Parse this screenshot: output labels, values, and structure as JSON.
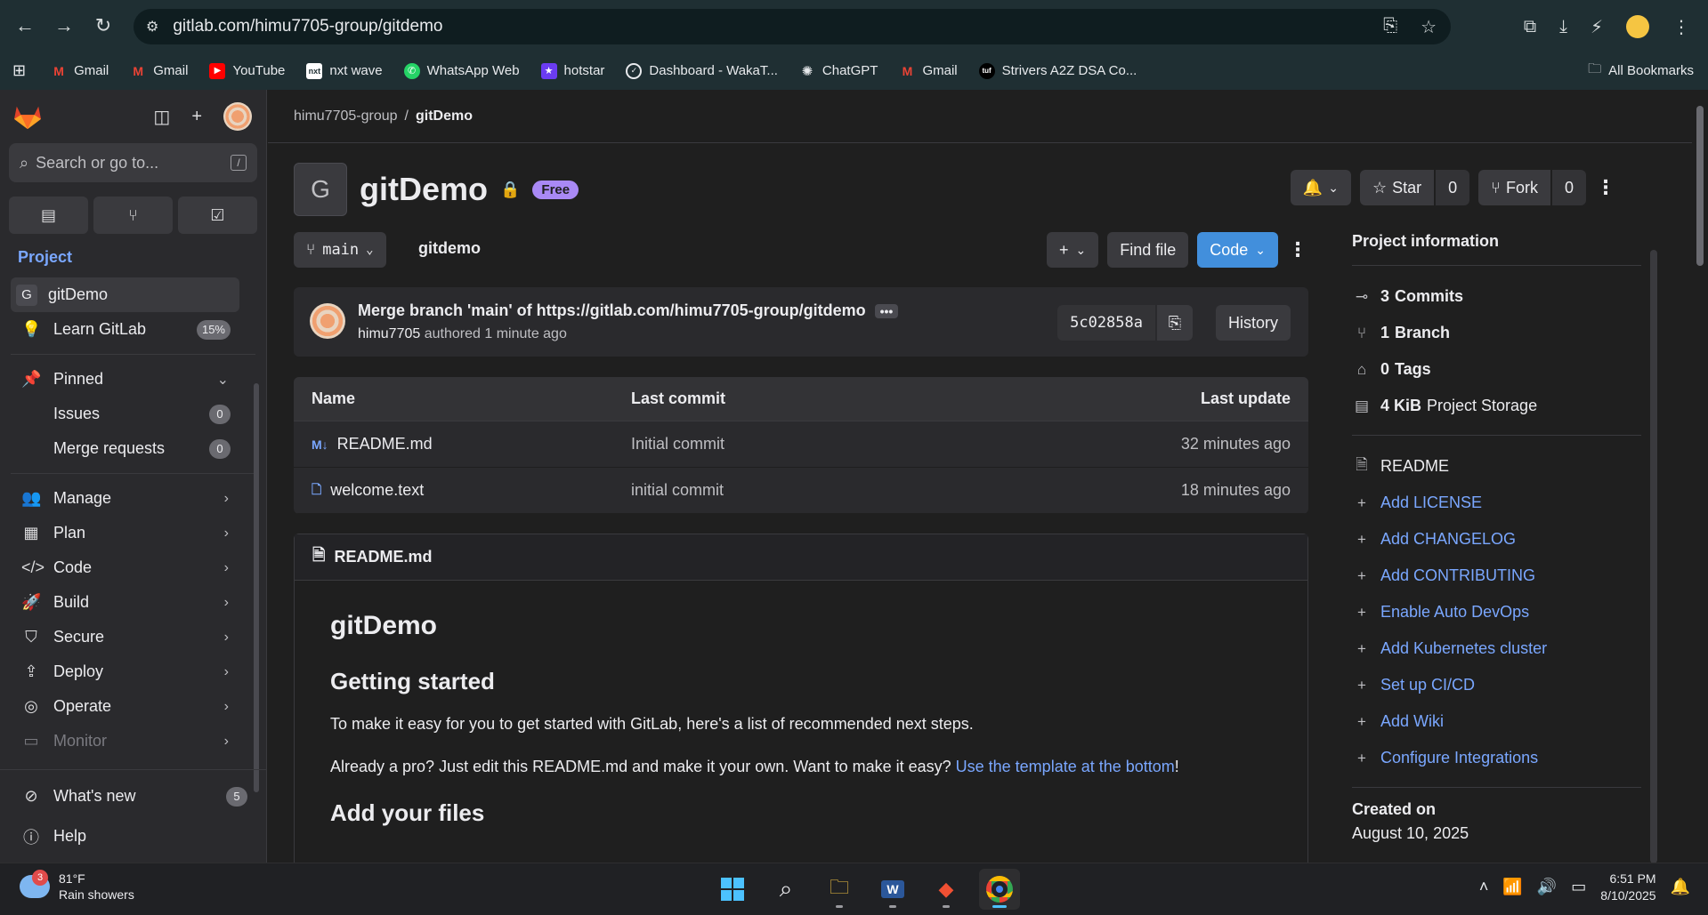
{
  "browser": {
    "url": "gitlab.com/himu7705-group/gitdemo",
    "bookmarks": [
      {
        "label": "Gmail",
        "icon": "gmail-icon"
      },
      {
        "label": "Gmail",
        "icon": "gmail-icon"
      },
      {
        "label": "YouTube",
        "icon": "youtube-icon"
      },
      {
        "label": "nxt wave",
        "icon": "nxtwave-icon"
      },
      {
        "label": "WhatsApp Web",
        "icon": "whatsapp-icon"
      },
      {
        "label": "hotstar",
        "icon": "hotstar-icon"
      },
      {
        "label": "Dashboard - WakaT...",
        "icon": "wakatime-icon"
      },
      {
        "label": "ChatGPT",
        "icon": "chatgpt-icon"
      },
      {
        "label": "Gmail",
        "icon": "gmail-icon"
      },
      {
        "label": "Strivers A2Z DSA Co...",
        "icon": "tuf-icon"
      }
    ],
    "all_bookmarks": "All Bookmarks"
  },
  "sidebar": {
    "search_placeholder": "Search or go to...",
    "search_kbd": "/",
    "section": "Project",
    "project_item": {
      "letter": "G",
      "label": "gitDemo"
    },
    "learn": {
      "label": "Learn GitLab",
      "badge": "15%"
    },
    "pinned": "Pinned",
    "pinned_items": [
      {
        "label": "Issues",
        "count": "0"
      },
      {
        "label": "Merge requests",
        "count": "0"
      }
    ],
    "nav": [
      {
        "label": "Manage",
        "icon": "users-icon"
      },
      {
        "label": "Plan",
        "icon": "plan-icon"
      },
      {
        "label": "Code",
        "icon": "code-icon"
      },
      {
        "label": "Build",
        "icon": "rocket-icon"
      },
      {
        "label": "Secure",
        "icon": "shield-icon"
      },
      {
        "label": "Deploy",
        "icon": "deploy-icon"
      },
      {
        "label": "Operate",
        "icon": "operate-icon"
      },
      {
        "label": "Monitor",
        "icon": "monitor-icon"
      }
    ],
    "whats_new": {
      "label": "What's new",
      "count": "5"
    },
    "help": "Help"
  },
  "breadcrumb": {
    "group": "himu7705-group",
    "separator": "/",
    "project": "gitDemo"
  },
  "project": {
    "avatar_letter": "G",
    "title": "gitDemo",
    "tier": "Free",
    "star_label": "Star",
    "star_count": "0",
    "fork_label": "Fork",
    "fork_count": "0"
  },
  "repo": {
    "branch": "main",
    "path": "gitdemo",
    "find_file": "Find file",
    "code": "Code"
  },
  "commit": {
    "message": "Merge branch 'main' of https://gitlab.com/himu7705-group/gitdemo",
    "author": "himu7705",
    "authored": "authored 1 minute ago",
    "sha": "5c02858a",
    "history": "History"
  },
  "files": {
    "headers": {
      "name": "Name",
      "last_commit": "Last commit",
      "last_update": "Last update"
    },
    "rows": [
      {
        "name": "README.md",
        "commit": "Initial commit",
        "updated": "32 minutes ago",
        "icon": "markdown-icon"
      },
      {
        "name": "welcome.text",
        "commit": "initial commit",
        "updated": "18 minutes ago",
        "icon": "file-icon"
      }
    ]
  },
  "readme": {
    "file": "README.md",
    "h1": "gitDemo",
    "h2_getting_started": "Getting started",
    "p1": "To make it easy for you to get started with GitLab, here's a list of recommended next steps.",
    "p2_pre": "Already a pro? Just edit this README.md and make it your own. Want to make it easy? ",
    "p2_link": "Use the template at the bottom",
    "p2_post": "!",
    "h2_add_files": "Add your files"
  },
  "info": {
    "title": "Project information",
    "commits_n": "3",
    "commits_label": "Commits",
    "branches_n": "1",
    "branches_label": "Branch",
    "tags_n": "0",
    "tags_label": "Tags",
    "storage_n": "4 KiB",
    "storage_label": "Project Storage",
    "readme": "README",
    "links": [
      "Add LICENSE",
      "Add CHANGELOG",
      "Add CONTRIBUTING",
      "Enable Auto DevOps",
      "Add Kubernetes cluster",
      "Set up CI/CD",
      "Add Wiki",
      "Configure Integrations"
    ],
    "created_label": "Created on",
    "created_date": "August 10, 2025"
  },
  "taskbar": {
    "weather_badge": "3",
    "temp": "81°F",
    "condition": "Rain showers",
    "time": "6:51 PM",
    "date": "8/10/2025"
  },
  "colors": {
    "accent": "#428fdc",
    "link": "#7aa7ff",
    "free_badge": "#a989f5"
  }
}
